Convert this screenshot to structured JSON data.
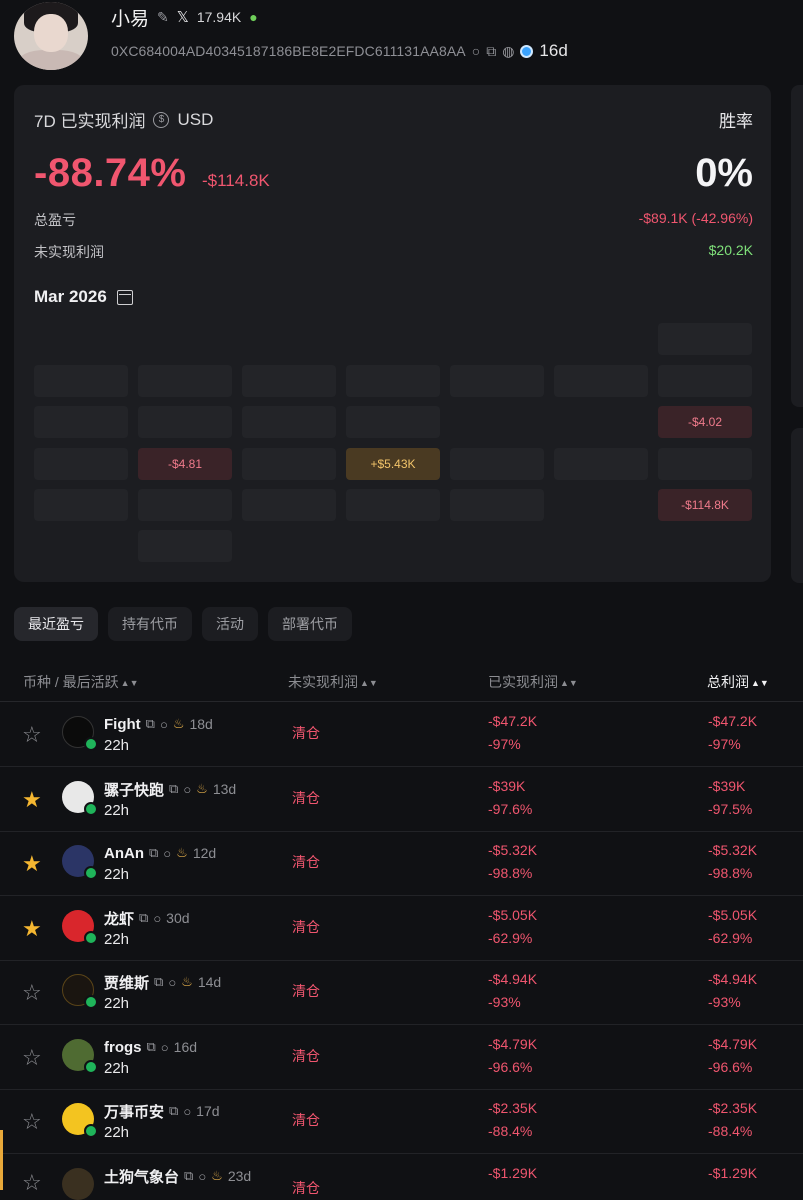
{
  "profile": {
    "name": "小易",
    "x_followers": "17.94K",
    "address": "0XC684004AD40345187186BE8E2EFDC611131AA8AA",
    "age": "16d"
  },
  "pnl": {
    "period": "7D 已实现利润",
    "currency": "USD",
    "winrate_label": "胜率",
    "pct": "-88.74%",
    "usd": "-$114.8K",
    "winrate": "0%",
    "total_label": "总盈亏",
    "total_value": "-$89.1K (-42.96%)",
    "unrealized_label": "未实现利润",
    "unrealized_value": "$20.2K",
    "month": "Mar 2026",
    "calendar_labels": {
      "c1": "-$4.02",
      "c2": "-$4.81",
      "c3": "+$5.43K",
      "c4": "-$114.8K"
    }
  },
  "tabs": [
    "最近盈亏",
    "持有代币",
    "活动",
    "部署代币"
  ],
  "table": {
    "headers": {
      "token": "币种 / 最后活跃",
      "unrealized": "未实现利润",
      "realized": "已实现利润",
      "total": "总利润"
    },
    "rows": [
      {
        "name": "Fight",
        "age": "18d",
        "time": "22h",
        "status": "清仓",
        "realized": "-$47.2K",
        "realized_pct": "-97%",
        "total": "-$47.2K",
        "total_pct": "-97%"
      },
      {
        "name": "骡子快跑",
        "age": "13d",
        "time": "22h",
        "status": "清仓",
        "realized": "-$39K",
        "realized_pct": "-97.6%",
        "total": "-$39K",
        "total_pct": "-97.5%"
      },
      {
        "name": "AnAn",
        "age": "12d",
        "time": "22h",
        "status": "清仓",
        "realized": "-$5.32K",
        "realized_pct": "-98.8%",
        "total": "-$5.32K",
        "total_pct": "-98.8%"
      },
      {
        "name": "龙虾",
        "age": "30d",
        "time": "22h",
        "status": "清仓",
        "realized": "-$5.05K",
        "realized_pct": "-62.9%",
        "total": "-$5.05K",
        "total_pct": "-62.9%"
      },
      {
        "name": "贾维斯",
        "age": "14d",
        "time": "22h",
        "status": "清仓",
        "realized": "-$4.94K",
        "realized_pct": "-93%",
        "total": "-$4.94K",
        "total_pct": "-93%"
      },
      {
        "name": "frogs",
        "age": "16d",
        "time": "22h",
        "status": "清仓",
        "realized": "-$4.79K",
        "realized_pct": "-96.6%",
        "total": "-$4.79K",
        "total_pct": "-96.6%"
      },
      {
        "name": "万事币安",
        "age": "17d",
        "time": "22h",
        "status": "清仓",
        "realized": "-$2.35K",
        "realized_pct": "-88.4%",
        "total": "-$2.35K",
        "total_pct": "-88.4%"
      },
      {
        "name": "土狗气象台",
        "age": "23d",
        "time": "",
        "status": "清仓",
        "realized": "-$1.29K",
        "realized_pct": "",
        "total": "-$1.29K",
        "total_pct": ""
      }
    ]
  }
}
